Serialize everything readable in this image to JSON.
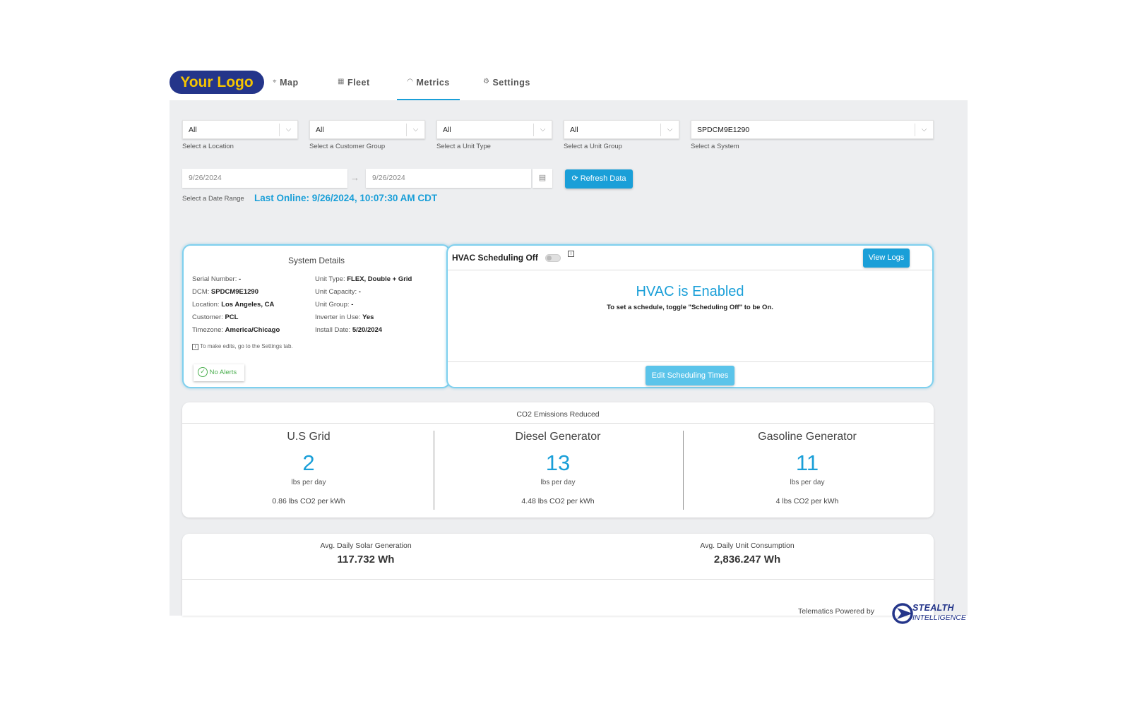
{
  "header": {
    "logo_text": "Your Logo",
    "tabs": [
      {
        "label": "Map",
        "icon": "map-pin-icon"
      },
      {
        "label": "Fleet",
        "icon": "grid-icon"
      },
      {
        "label": "Metrics",
        "icon": "gauge-icon",
        "active": true
      },
      {
        "label": "Settings",
        "icon": "gear-icon"
      }
    ]
  },
  "filters": {
    "location": {
      "value": "All",
      "label": "Select a Location"
    },
    "customer_group": {
      "value": "All",
      "label": "Select a Customer Group"
    },
    "unit_type": {
      "value": "All",
      "label": "Select a Unit Type"
    },
    "unit_group": {
      "value": "All",
      "label": "Select a Unit Group"
    },
    "system": {
      "value": "SPDCM9E1290",
      "label": "Select a System"
    },
    "date_start": "9/26/2024",
    "date_end": "9/26/2024",
    "date_label": "Select a Date Range",
    "refresh_label": "Refresh Data",
    "last_online": "Last Online:  9/26/2024, 10:07:30 AM CDT"
  },
  "system_details": {
    "title": "System Details",
    "serial_label": "Serial Number:",
    "serial_value": "-",
    "dcm_label": "DCM:",
    "dcm_value": "SPDCM9E1290",
    "location_label": "Location:",
    "location_value": "Los Angeles, CA",
    "customer_label": "Customer:",
    "customer_value": "PCL",
    "timezone_label": "Timezone:",
    "timezone_value": "America/Chicago",
    "unit_type_label": "Unit Type:",
    "unit_type_value": "FLEX, Double + Grid",
    "capacity_label": "Unit Capacity:",
    "capacity_value": "-",
    "unit_group_label": "Unit Group:",
    "unit_group_value": "-",
    "inverter_label": "Inverter in Use:",
    "inverter_value": "Yes",
    "install_label": "Install Date:",
    "install_value": "5/20/2024",
    "edit_note": "To make edits, go to the Settings tab.",
    "alerts_label": "No Alerts"
  },
  "hvac": {
    "scheduling_label": "HVAC Scheduling Off",
    "view_logs": "View Logs",
    "status": "HVAC is Enabled",
    "hint": "To set a schedule, toggle \"Scheduling Off\" to be On.",
    "edit_button": "Edit Scheduling Times"
  },
  "co2": {
    "title": "CO2 Emissions Reduced",
    "columns": [
      {
        "name": "U.S Grid",
        "value": "2",
        "unit": "lbs per day",
        "rate": "0.86 lbs CO2 per kWh"
      },
      {
        "name": "Diesel Generator",
        "value": "13",
        "unit": "lbs per day",
        "rate": "4.48 lbs CO2 per kWh"
      },
      {
        "name": "Gasoline Generator",
        "value": "11",
        "unit": "lbs per day",
        "rate": "4 lbs CO2 per kWh"
      }
    ]
  },
  "averages": {
    "solar_label": "Avg. Daily Solar Generation",
    "solar_value": "117.732 Wh",
    "consumption_label": "Avg. Daily Unit Consumption",
    "consumption_value": "2,836.247 Wh"
  },
  "footer": {
    "powered_by": "Telematics Powered by",
    "brand_line1": "STEALTH",
    "brand_line2": "INTELLIGENCE"
  },
  "colors": {
    "accent": "#1a9fd8",
    "logo_bg": "#24358a",
    "logo_text": "#f5c400",
    "success": "#4caf50"
  }
}
